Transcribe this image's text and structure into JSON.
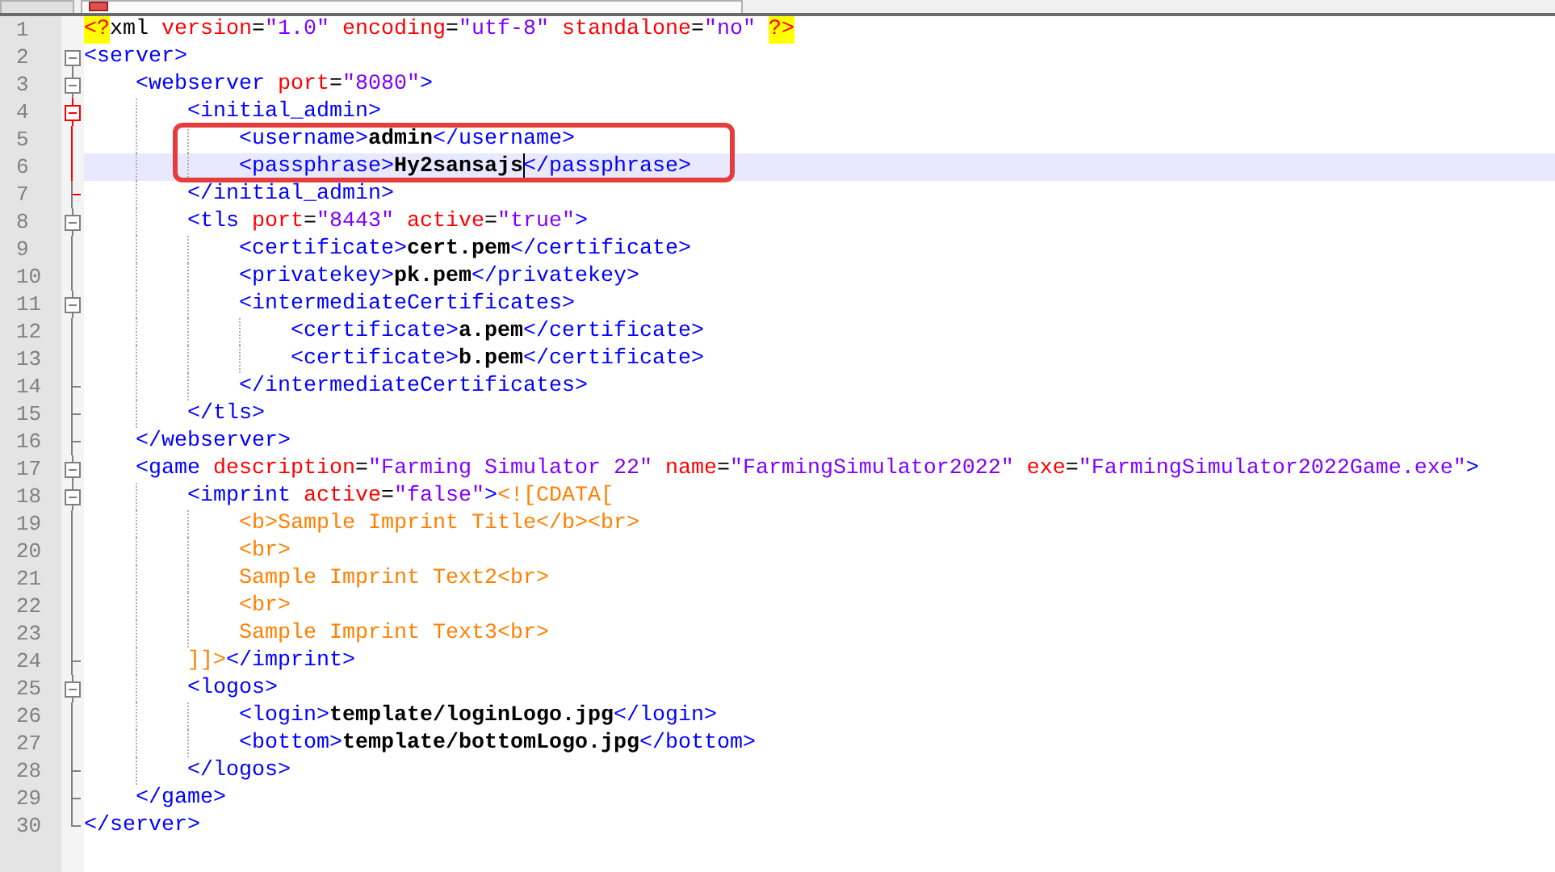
{
  "lines": [
    {
      "number": "1",
      "tokens": [
        {
          "kind": "decl",
          "text": "<?"
        },
        {
          "kind": "name",
          "text": "xml"
        },
        {
          "kind": "attr",
          "text": " version"
        },
        {
          "kind": "eq",
          "text": "="
        },
        {
          "kind": "value",
          "text": "\"1.0\""
        },
        {
          "kind": "attr",
          "text": " encoding"
        },
        {
          "kind": "eq",
          "text": "="
        },
        {
          "kind": "value",
          "text": "\"utf-8\""
        },
        {
          "kind": "attr",
          "text": " standalone"
        },
        {
          "kind": "eq",
          "text": "="
        },
        {
          "kind": "value",
          "text": "\"no\" "
        },
        {
          "kind": "decl",
          "text": "?>"
        }
      ]
    },
    {
      "number": "2",
      "expanded": true,
      "tokens": [
        {
          "kind": "tag",
          "text": "<server>"
        }
      ],
      "children": [
        {
          "number": "3",
          "expanded": true,
          "tokens": [
            {
              "kind": "tag",
              "text": "<webserver"
            },
            {
              "kind": "attr",
              "text": " port"
            },
            {
              "kind": "eq",
              "text": "="
            },
            {
              "kind": "value",
              "text": "\"8080\""
            },
            {
              "kind": "tag",
              "text": ">"
            }
          ],
          "children": [
            {
              "number": "4",
              "expanded": true,
              "highlighted": true,
              "tokens": [
                {
                  "kind": "tag",
                  "text": "<initial_admin>"
                }
              ],
              "children": [
                {
                  "number": "5",
                  "tokens": [
                    {
                      "kind": "tag",
                      "text": "<username>"
                    },
                    {
                      "kind": "text",
                      "text": "admin"
                    },
                    {
                      "kind": "tag",
                      "text": "</username>"
                    }
                  ]
                },
                {
                  "number": "6",
                  "current": true,
                  "tokens": [
                    {
                      "kind": "tag",
                      "text": "<passphrase>"
                    },
                    {
                      "kind": "text",
                      "text": "Hy2sansajs",
                      "caret": true
                    },
                    {
                      "kind": "tag",
                      "text": "</passphrase>"
                    }
                  ]
                }
              ]
            },
            {
              "number": "7",
              "tokens": [
                {
                  "kind": "tag",
                  "text": "</initial_admin>"
                }
              ]
            },
            {
              "number": "8",
              "expanded": true,
              "tokens": [
                {
                  "kind": "tag",
                  "text": "<tls"
                },
                {
                  "kind": "attr",
                  "text": " port"
                },
                {
                  "kind": "eq",
                  "text": "="
                },
                {
                  "kind": "value",
                  "text": "\"8443\""
                },
                {
                  "kind": "attr",
                  "text": " active"
                },
                {
                  "kind": "eq",
                  "text": "="
                },
                {
                  "kind": "value",
                  "text": "\"true\""
                },
                {
                  "kind": "tag",
                  "text": ">"
                }
              ],
              "children": [
                {
                  "number": "9",
                  "tokens": [
                    {
                      "kind": "tag",
                      "text": "<certificate>"
                    },
                    {
                      "kind": "text",
                      "text": "cert.pem"
                    },
                    {
                      "kind": "tag",
                      "text": "</certificate>"
                    }
                  ]
                },
                {
                  "number": "10",
                  "tokens": [
                    {
                      "kind": "tag",
                      "text": "<privatekey>"
                    },
                    {
                      "kind": "text",
                      "text": "pk.pem"
                    },
                    {
                      "kind": "tag",
                      "text": "</privatekey>"
                    }
                  ]
                },
                {
                  "number": "11",
                  "expanded": true,
                  "tokens": [
                    {
                      "kind": "tag",
                      "text": "<intermediateCertificates>"
                    }
                  ],
                  "children": [
                    {
                      "number": "12",
                      "tokens": [
                        {
                          "kind": "tag",
                          "text": "<certificate>"
                        },
                        {
                          "kind": "text",
                          "text": "a.pem"
                        },
                        {
                          "kind": "tag",
                          "text": "</certificate>"
                        }
                      ]
                    },
                    {
                      "number": "13",
                      "tokens": [
                        {
                          "kind": "tag",
                          "text": "<certificate>"
                        },
                        {
                          "kind": "text",
                          "text": "b.pem"
                        },
                        {
                          "kind": "tag",
                          "text": "</certificate>"
                        }
                      ]
                    }
                  ]
                },
                {
                  "number": "14",
                  "tokens": [
                    {
                      "kind": "tag",
                      "text": "</intermediateCertificates>"
                    }
                  ]
                }
              ]
            },
            {
              "number": "15",
              "tokens": [
                {
                  "kind": "tag",
                  "text": "</tls>"
                }
              ]
            }
          ]
        },
        {
          "number": "16",
          "tokens": [
            {
              "kind": "tag",
              "text": "</webserver>"
            }
          ]
        },
        {
          "number": "17",
          "expanded": true,
          "tokens": [
            {
              "kind": "tag",
              "text": "<game"
            },
            {
              "kind": "attr",
              "text": " description"
            },
            {
              "kind": "eq",
              "text": "="
            },
            {
              "kind": "value",
              "text": "\"Farming Simulator 22\""
            },
            {
              "kind": "attr",
              "text": " name"
            },
            {
              "kind": "eq",
              "text": "="
            },
            {
              "kind": "value",
              "text": "\"FarmingSimulator2022\""
            },
            {
              "kind": "attr",
              "text": " exe"
            },
            {
              "kind": "eq",
              "text": "="
            },
            {
              "kind": "value",
              "text": "\"FarmingSimulator2022Game.exe\""
            },
            {
              "kind": "tag",
              "text": ">"
            }
          ],
          "children": [
            {
              "number": "18",
              "expanded": true,
              "tokens": [
                {
                  "kind": "tag",
                  "text": "<imprint"
                },
                {
                  "kind": "attr",
                  "text": " active"
                },
                {
                  "kind": "eq",
                  "text": "="
                },
                {
                  "kind": "value",
                  "text": "\"false\""
                },
                {
                  "kind": "tag",
                  "text": ">"
                },
                {
                  "kind": "cdata",
                  "text": "<![CDATA["
                }
              ],
              "children": [
                {
                  "number": "19",
                  "tokens": [
                    {
                      "kind": "cdata",
                      "text": "<b>Sample Imprint Title</b><br>"
                    }
                  ]
                },
                {
                  "number": "20",
                  "tokens": [
                    {
                      "kind": "cdata",
                      "text": "<br>"
                    }
                  ]
                },
                {
                  "number": "21",
                  "tokens": [
                    {
                      "kind": "cdata",
                      "text": "Sample Imprint Text2<br>"
                    }
                  ]
                },
                {
                  "number": "22",
                  "tokens": [
                    {
                      "kind": "cdata",
                      "text": "<br>"
                    }
                  ]
                },
                {
                  "number": "23",
                  "tokens": [
                    {
                      "kind": "cdata",
                      "text": "Sample Imprint Text3<br>"
                    }
                  ]
                }
              ]
            },
            {
              "number": "24",
              "tokens": [
                {
                  "kind": "cdata",
                  "text": "]]>"
                },
                {
                  "kind": "tag",
                  "text": "</imprint>"
                }
              ]
            },
            {
              "number": "25",
              "expanded": true,
              "tokens": [
                {
                  "kind": "tag",
                  "text": "<logos>"
                }
              ],
              "children": [
                {
                  "number": "26",
                  "tokens": [
                    {
                      "kind": "tag",
                      "text": "<login>"
                    },
                    {
                      "kind": "text",
                      "text": "template/loginLogo.jpg"
                    },
                    {
                      "kind": "tag",
                      "text": "</login>"
                    }
                  ]
                },
                {
                  "number": "27",
                  "tokens": [
                    {
                      "kind": "tag",
                      "text": "<bottom>"
                    },
                    {
                      "kind": "text",
                      "text": "template/bottomLogo.jpg"
                    },
                    {
                      "kind": "tag",
                      "text": "</bottom>"
                    }
                  ]
                }
              ]
            },
            {
              "number": "28",
              "tokens": [
                {
                  "kind": "tag",
                  "text": "</logos>"
                }
              ]
            }
          ]
        },
        {
          "number": "29",
          "tokens": [
            {
              "kind": "tag",
              "text": "</game>"
            }
          ]
        }
      ]
    },
    {
      "number": "30",
      "tokens": [
        {
          "kind": "tag",
          "text": "</server>"
        }
      ]
    }
  ]
}
